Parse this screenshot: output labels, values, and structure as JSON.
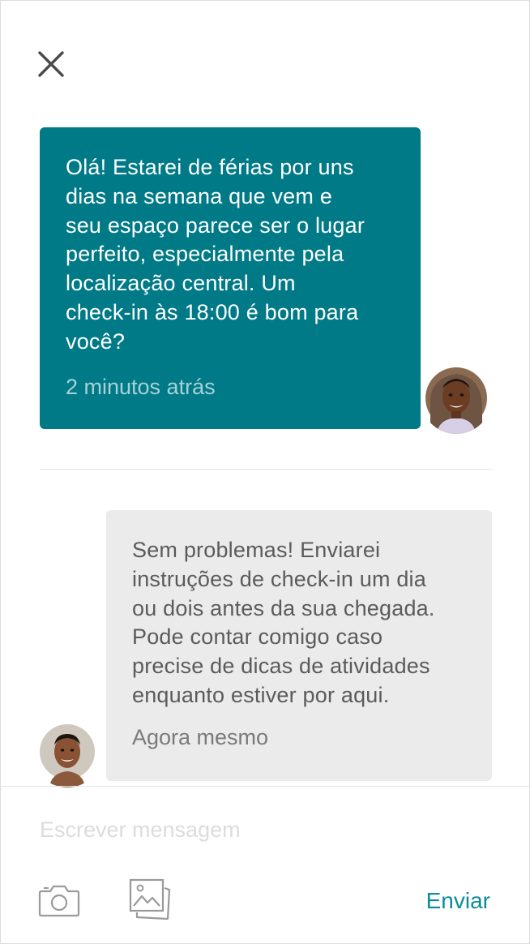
{
  "header": {
    "close_icon": "close-icon"
  },
  "messages": [
    {
      "sender": "guest",
      "text": "Olá! Estarei de férias por uns\ndias na semana que vem e\nseu espaço parece ser o lugar\nperfeito, especialmente pela\nlocalização central. Um\ncheck-in às 18:00 é bom para\nvocê?",
      "time": "2 minutos atrás",
      "color": "#007a87"
    },
    {
      "sender": "host",
      "text": "Sem problemas! Enviarei\ninstruções de check-in um dia\nou dois antes da sua chegada.\nPode contar comigo caso\nprecise de dicas de atividades\nenquanto estiver por aqui.",
      "time": "Agora mesmo",
      "color": "#ebebeb"
    }
  ],
  "composer": {
    "value": "",
    "placeholder": "Escrever mensagem",
    "camera_icon": "camera-icon",
    "gallery_icon": "image-gallery-icon",
    "send_label": "Enviar",
    "send_color": "#0a8d96"
  }
}
